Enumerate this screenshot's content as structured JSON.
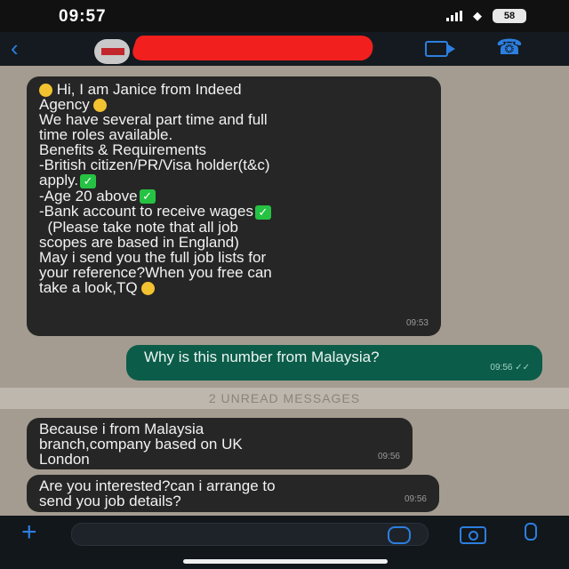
{
  "status_bar": {
    "time": "09:57",
    "battery": "58"
  },
  "messages": {
    "m1": {
      "lines": [
        "Hi, I am Janice from Indeed",
        "Agency",
        "",
        "We have several part time and full",
        "time roles available.",
        "Benefits & Requirements",
        "",
        "-British citizen/PR/Visa holder(t&c)",
        "apply.",
        "-Age 20 above",
        "-Bank account to receive wages",
        "  (Please take note that all job",
        "scopes are based in England)",
        "",
        "May i send you the full job lists for",
        "your reference?When you free can",
        "take a look,TQ"
      ],
      "time": "09:53"
    },
    "m2": {
      "text": "Why is this number from Malaysia?",
      "time": "09:56"
    },
    "m3": {
      "lines": [
        "Because i from Malaysia",
        "branch,company based on UK",
        "London"
      ],
      "time": "09:56"
    },
    "m4": {
      "lines": [
        "Are you interested?can i arrange to",
        "send you job details?"
      ],
      "time": "09:56"
    }
  },
  "unread_banner": "2 UNREAD MESSAGES",
  "colors": {
    "accent": "#2c7fe0",
    "incoming_bubble": "#262626",
    "outgoing_bubble": "#0c5c4a",
    "check_green": "#26c243"
  },
  "icons": [
    "back-icon",
    "video-call-icon",
    "voice-call-icon",
    "plus-icon",
    "sticker-icon",
    "camera-icon",
    "microphone-icon"
  ]
}
